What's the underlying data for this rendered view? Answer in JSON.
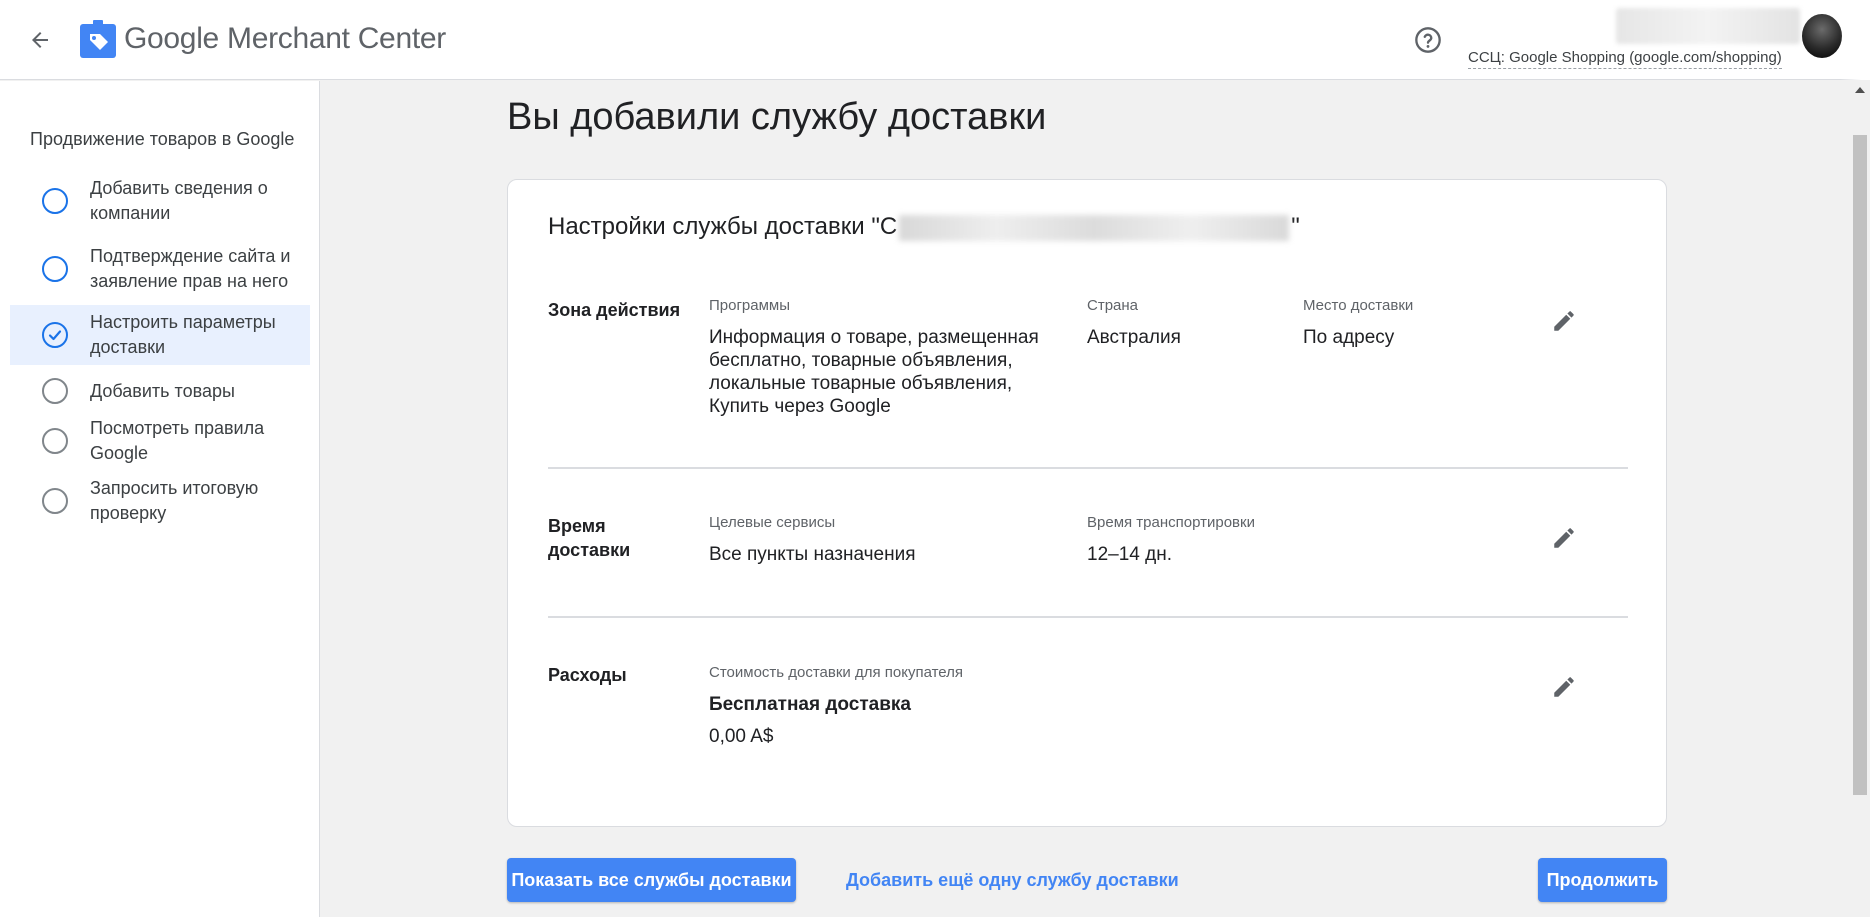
{
  "header": {
    "brand_google": "Google",
    "brand_product": "Merchant Center",
    "account_sub": "ССЦ: Google Shopping (google.com/shopping)"
  },
  "sidebar": {
    "title": "Продвижение товаров в Google",
    "steps": [
      {
        "label": "Добавить сведения о компании",
        "state": "incomplete"
      },
      {
        "label": "Подтверждение сайта и заявление прав на него",
        "state": "incomplete"
      },
      {
        "label": "Настроить параметры доставки",
        "state": "done-active"
      },
      {
        "label": "Добавить товары",
        "state": "todo"
      },
      {
        "label": "Посмотреть правила Google",
        "state": "todo"
      },
      {
        "label": "Запросить итоговую проверку",
        "state": "todo"
      }
    ]
  },
  "main": {
    "page_title": "Вы добавили службу доставки",
    "card": {
      "title_prefix": "Настройки службы доставки \"С",
      "title_suffix": "\"",
      "zone": {
        "label": "Зона действия",
        "programs_label": "Программы",
        "programs_value": "Информация о товаре, размещенная бесплатно, товарные объявления, локальные товарные объявления, Купить через Google",
        "country_label": "Страна",
        "country_value": "Австралия",
        "place_label": "Место доставки",
        "place_value": "По адресу"
      },
      "time": {
        "label": "Время доставки",
        "services_label": "Целевые сервисы",
        "services_value": "Все пункты назначения",
        "transit_label": "Время транспортировки",
        "transit_value": "12–14 дн."
      },
      "cost": {
        "label": "Расходы",
        "cost_label": "Стоимость доставки для покупателя",
        "cost_title": "Бесплатная доставка",
        "cost_value": "0,00 A$"
      }
    },
    "buttons": {
      "show_all": "Показать все службы доставки",
      "add_another": "Добавить ещё одну службу доставки",
      "continue": "Продолжить"
    }
  },
  "colors": {
    "accent": "#4285f4",
    "step_blue": "#1a73e8",
    "active_bg": "#e8f0fe"
  },
  "icons": [
    "back-arrow-icon",
    "merchant-center-logo-icon",
    "help-icon",
    "check-icon",
    "pencil-icon"
  ]
}
